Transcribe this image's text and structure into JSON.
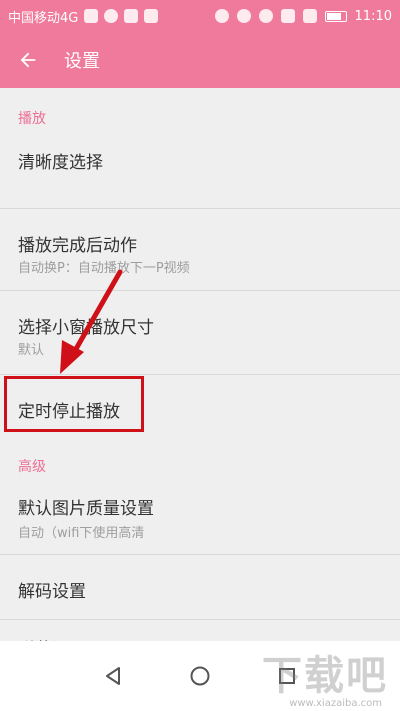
{
  "status_bar": {
    "carrier": "中国移动4G",
    "time": "11:10"
  },
  "app_bar": {
    "title": "设置",
    "back_icon": "arrow-back-icon"
  },
  "sections": {
    "playback_header": "播放",
    "advanced_header": "高级"
  },
  "items": {
    "clarity": {
      "title": "清晰度选择"
    },
    "after_play": {
      "title": "播放完成后动作",
      "subtitle": "自动换P：自动播放下一P视频"
    },
    "mini_window": {
      "title": "选择小窗播放尺寸",
      "subtitle": "默认"
    },
    "timer_stop": {
      "title": "定时停止播放"
    },
    "image_quality": {
      "title": "默认图片质量设置",
      "subtitle": "自动（wifi下使用高清"
    },
    "decode": {
      "title": "解码设置"
    },
    "danmaku": {
      "title": "弹幕设置"
    }
  },
  "watermark": {
    "brand": "下载吧",
    "url": "www.xiazaiba.com"
  },
  "colors": {
    "accent": "#f07a9c",
    "section_header": "#ee6f95",
    "highlight": "#d01018"
  }
}
